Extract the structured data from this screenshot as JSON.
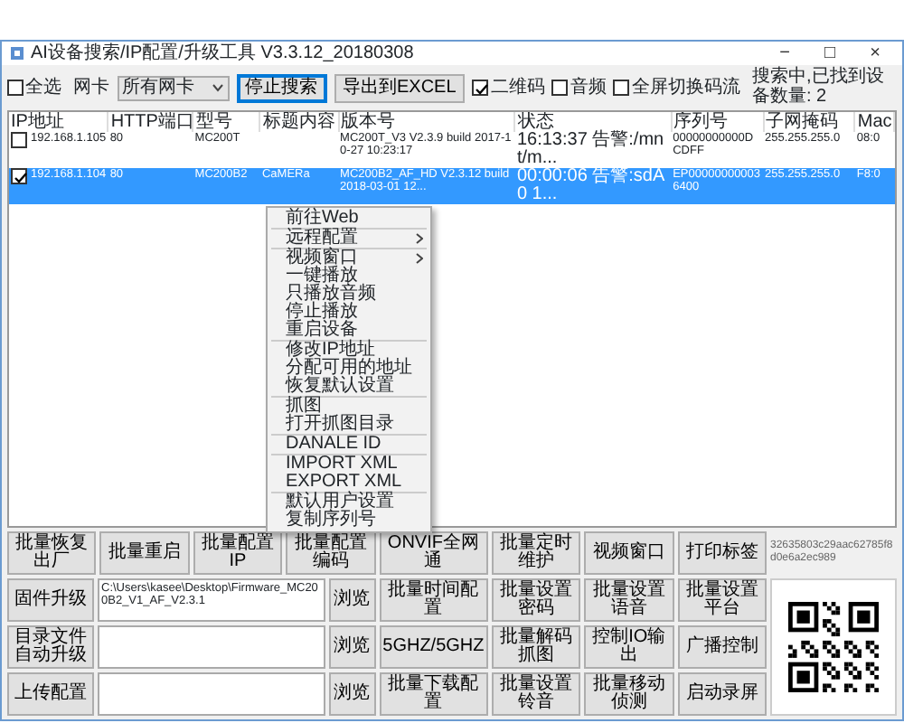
{
  "window": {
    "title": "AI设备搜索/IP配置/升级工具 V3.3.12_20180308",
    "controls": [
      "−",
      "□",
      "×"
    ]
  },
  "toolbar": {
    "select_all": {
      "label": "全选",
      "checked": false
    },
    "adapter": {
      "label": "网卡",
      "value": "所有网卡"
    },
    "buttons": [
      {
        "label": "停止搜索",
        "focused": true
      },
      {
        "label": "导出到EXCEL",
        "focused": false
      }
    ],
    "options": [
      {
        "label": "二维码",
        "checked": true
      },
      {
        "label": "音频",
        "checked": false
      },
      {
        "label": "全屏切换码流",
        "checked": false
      }
    ],
    "status": "搜索中,已找到设备数量: 2"
  },
  "table": {
    "columns": [
      "IP地址",
      "HTTP端口",
      "型号",
      "标题内容",
      "版本号",
      "状态",
      "序列号",
      "子网掩码",
      "Mac"
    ],
    "rows": [
      {
        "checked": false,
        "selected": false,
        "cells": [
          "192.168.1.105",
          "80",
          "MC200T",
          "",
          "MC200T_V3 V2.3.9 build 2017-10-27 10:23:17",
          "16:13:37 告警:/mnt/m...",
          "00000000000DCDFF",
          "255.255.255.0",
          "08:0"
        ]
      },
      {
        "checked": true,
        "selected": true,
        "cells": [
          "192.168.1.104",
          "80",
          "MC200B2",
          "CaMERa",
          "MC200B2_AF_HD V2.3.12 build 2018-03-01 12...",
          "00:00:06 告警:sdA0 1...",
          "EP000000000036400",
          "255.255.255.0",
          "F8:0"
        ]
      }
    ]
  },
  "context_menu": {
    "groups": [
      [
        {
          "label": "前往Web",
          "submenu": false
        }
      ],
      [
        {
          "label": "远程配置",
          "submenu": true
        }
      ],
      [
        {
          "label": "视频窗口",
          "submenu": true
        },
        {
          "label": "一键播放",
          "submenu": false
        },
        {
          "label": "只播放音频",
          "submenu": false
        },
        {
          "label": "停止播放",
          "submenu": false
        },
        {
          "label": "重启设备",
          "submenu": false
        }
      ],
      [
        {
          "label": "修改IP地址",
          "submenu": false
        },
        {
          "label": "分配可用的地址",
          "submenu": false
        },
        {
          "label": "恢复默认设置",
          "submenu": false
        }
      ],
      [
        {
          "label": "抓图",
          "submenu": false
        },
        {
          "label": "打开抓图目录",
          "submenu": false
        }
      ],
      [
        {
          "label": "DANALE ID",
          "submenu": false
        }
      ],
      [
        {
          "label": "IMPORT XML",
          "submenu": false
        },
        {
          "label": "EXPORT XML",
          "submenu": false
        }
      ],
      [
        {
          "label": "默认用户设置",
          "submenu": false
        },
        {
          "label": "复制序列号",
          "submenu": false
        }
      ]
    ]
  },
  "batch_buttons": [
    "批量恢复出厂",
    "批量重启",
    "批量配置IP",
    "批量配置编码",
    "ONVIF全网通",
    "批量定时维护",
    "视频窗口",
    "打印标签"
  ],
  "device_id": "32635803c29aac62785f8d0e6a2ec989",
  "file_rows": [
    {
      "label": "固件升级",
      "path": "C:\\Users\\kasee\\Desktop\\Firmware_MC200B2_V1_AF_V2.3.1",
      "browse": "浏览",
      "buttons": [
        "批量时间配置",
        "批量设置密码",
        "批量设置语音",
        "批量设置平台"
      ]
    },
    {
      "label": "目录文件自动升级",
      "browse": "浏览",
      "buttons": [
        "5GHZ/5GHZ",
        "批量解码抓图",
        "控制IO输出",
        "广播控制"
      ]
    },
    {
      "label": "上传配置",
      "browse": "浏览",
      "buttons": [
        "批量下载配置",
        "批量设置铃音",
        "批量移动侦测",
        "启动录屏"
      ]
    }
  ]
}
